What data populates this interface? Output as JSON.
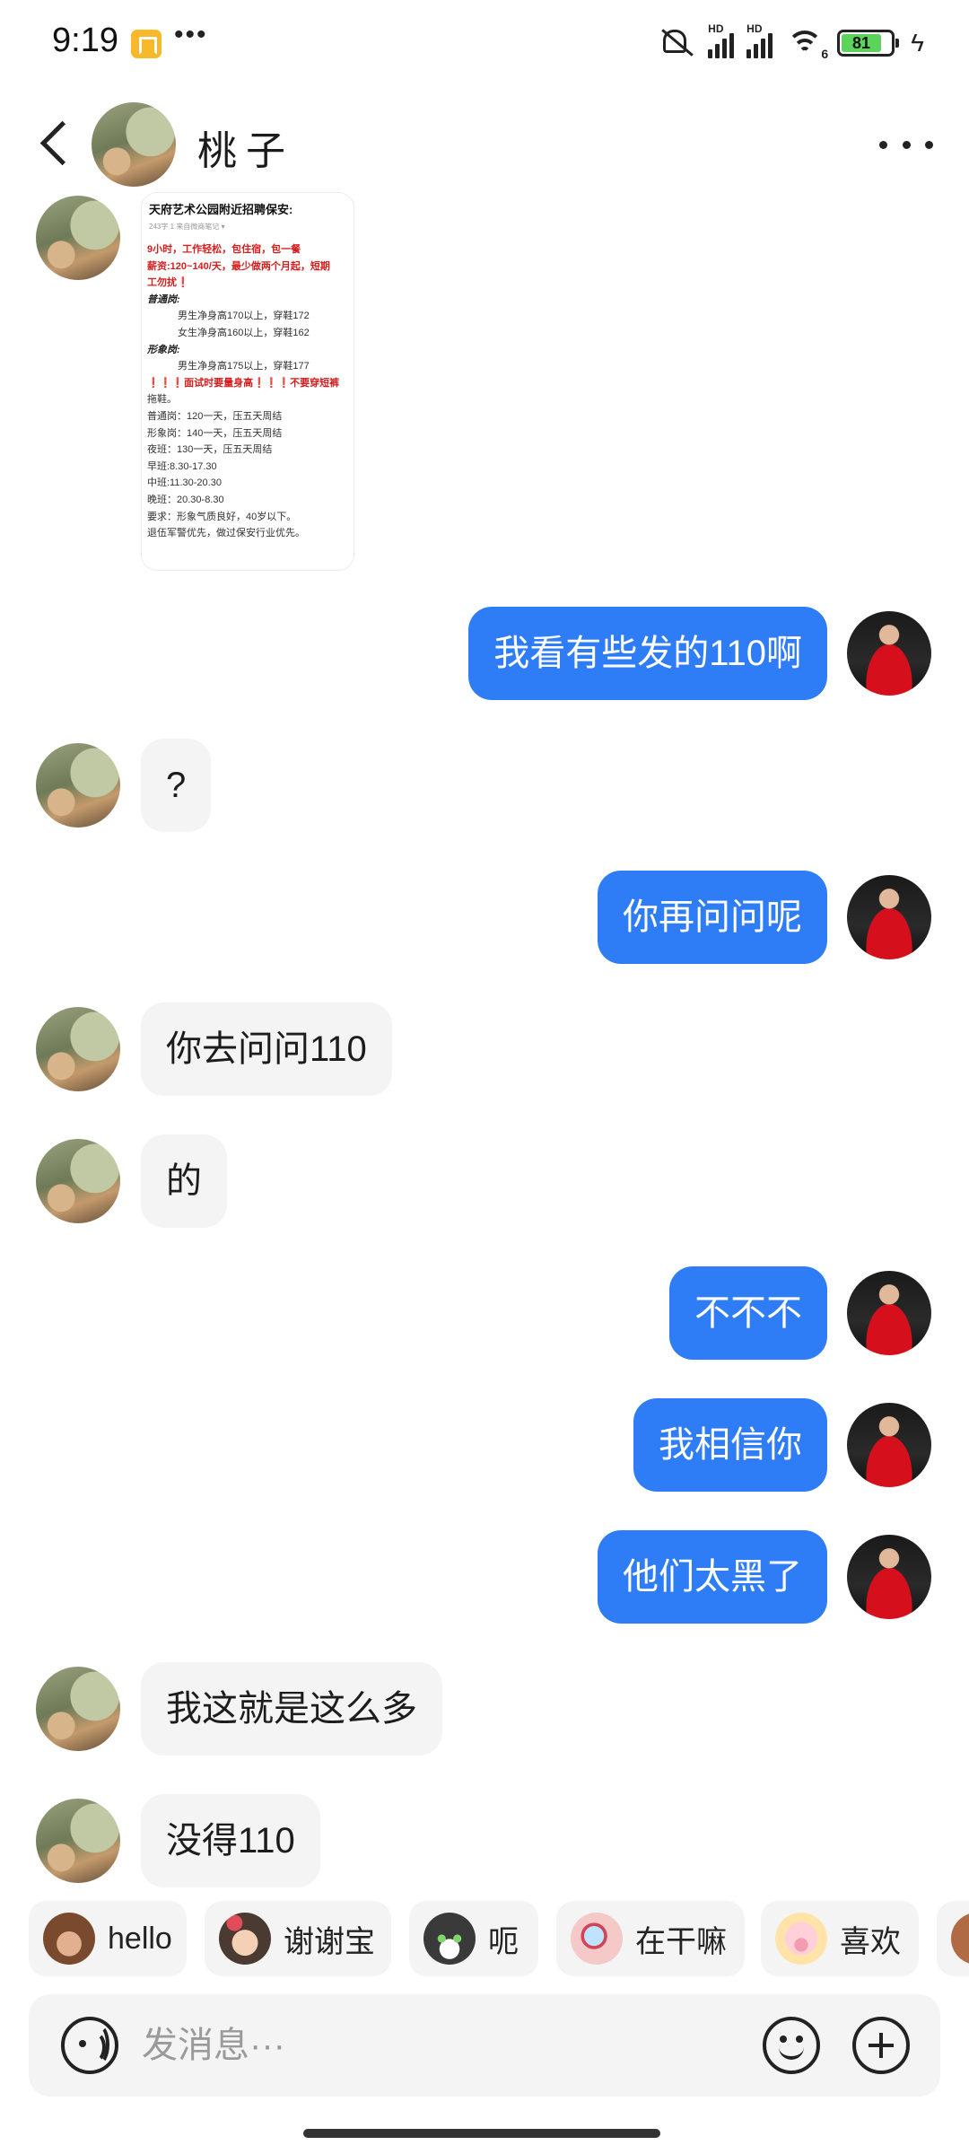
{
  "status_bar": {
    "time": "9:19",
    "signal_label_1": "HD",
    "signal_label_2": "HD",
    "wifi_label": "6",
    "battery_level": "81"
  },
  "header": {
    "contact_name": "桃子",
    "back_icon": "chevron-left-icon",
    "more_icon": "more-horizontal-icon"
  },
  "shared_image": {
    "title": "天府艺术公园附近招聘保安:",
    "meta": "243字 1 来自微商笔记 ▾",
    "lines": [
      "9小时，工作轻松，包住宿，包一餐",
      "薪资:120~140/天，最少做两个月起，短期",
      "工勿扰❗",
      "普通岗:",
      "男生净身高170以上，穿鞋172",
      "女生净身高160以上，穿鞋162",
      "形象岗:",
      "男生净身高175以上，穿鞋177",
      "❗❗❗面试时要量身高❗❗❗不要穿短裤",
      "拖鞋。",
      "普通岗：120一天，压五天周结",
      "形象岗：140一天，压五天周结",
      "夜班：130一天，压五天周结",
      "早班:8.30-17.30",
      "中班:11.30-20.30",
      "晚班：20.30-8.30",
      "要求：形象气质良好，40岁以下。",
      "退伍军警优先，做过保安行业优先。"
    ]
  },
  "messages": [
    {
      "from": "me",
      "text": "我看有些发的110啊"
    },
    {
      "from": "her",
      "text": "?"
    },
    {
      "from": "me",
      "text": "你再问问呢"
    },
    {
      "from": "her",
      "text": "你去问问110"
    },
    {
      "from": "her",
      "text": "的"
    },
    {
      "from": "me",
      "text": "不不不"
    },
    {
      "from": "me",
      "text": "我相信你"
    },
    {
      "from": "me",
      "text": "他们太黑了"
    },
    {
      "from": "her",
      "text": "我这就是这么多"
    },
    {
      "from": "her",
      "text": "没得110"
    }
  ],
  "quick_replies": [
    {
      "label": "hello",
      "icon": "monkey-sticker-icon"
    },
    {
      "label": "谢谢宝",
      "icon": "girl-sticker-icon"
    },
    {
      "label": "呃",
      "icon": "cat-sticker-icon"
    },
    {
      "label": "在干嘛",
      "icon": "magnifier-sticker-icon"
    },
    {
      "label": "喜欢",
      "icon": "pig-sticker-icon"
    }
  ],
  "input": {
    "placeholder": "发消息···",
    "voice_icon": "voice-icon",
    "emoji_icon": "emoji-icon",
    "plus_icon": "plus-circle-icon"
  },
  "colors": {
    "outgoing_bubble": "#2f7df6",
    "incoming_bubble": "#f4f4f4",
    "battery_fill": "#5cd35c"
  }
}
